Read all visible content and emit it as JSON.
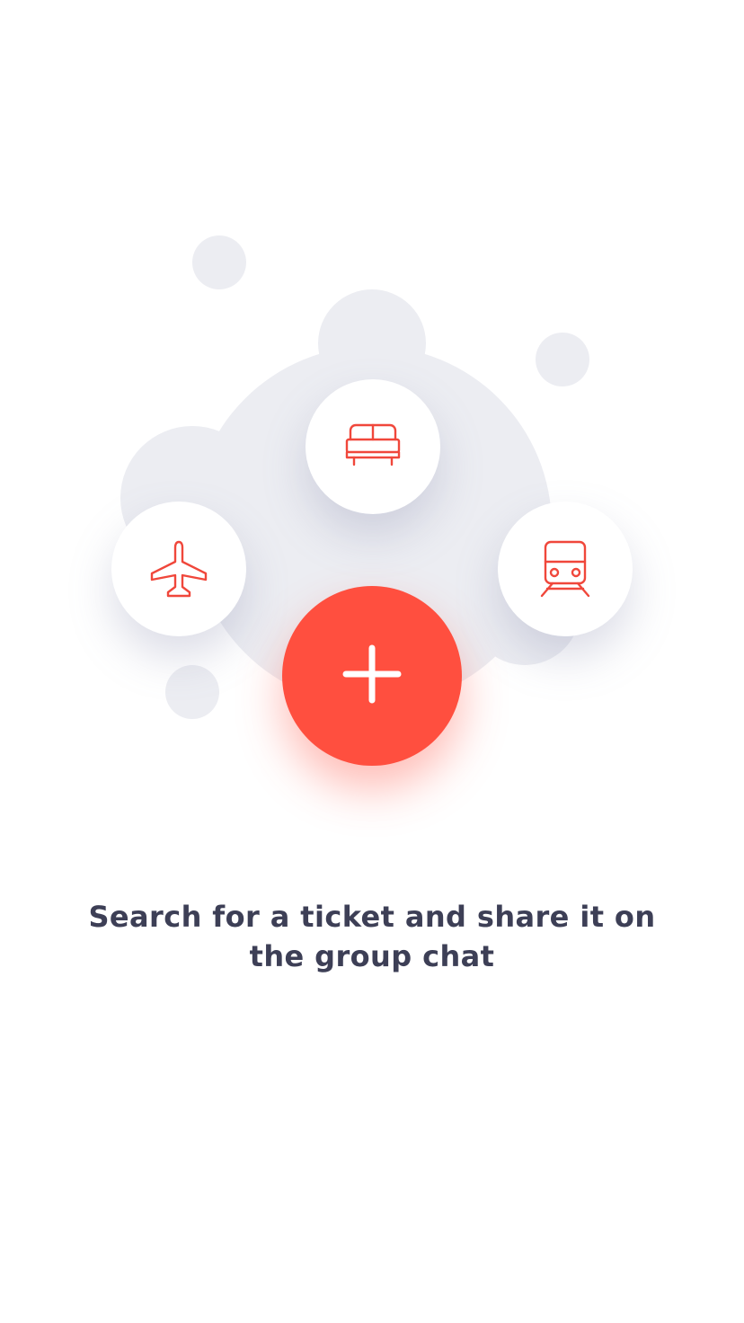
{
  "illustration": {
    "options": [
      {
        "icon": "bed-icon",
        "kind": "hotel"
      },
      {
        "icon": "airplane-icon",
        "kind": "flight"
      },
      {
        "icon": "train-icon",
        "kind": "train"
      }
    ],
    "add_button": {
      "icon": "plus-icon"
    }
  },
  "message": {
    "text": "Search for a ticket and share it on the group chat"
  },
  "colors": {
    "accent": "#ff4f3f",
    "icon_stroke": "#f0473b",
    "bubble": "#ecedf2",
    "text": "#3d3f56",
    "background": "#ffffff"
  }
}
